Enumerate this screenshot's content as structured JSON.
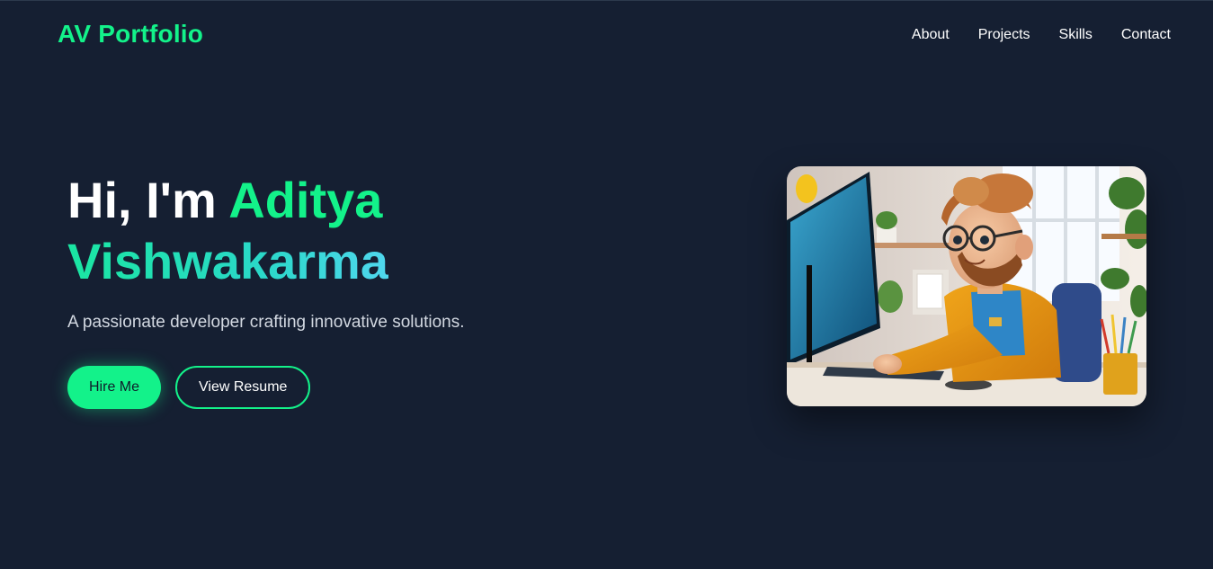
{
  "header": {
    "logo": "AV Portfolio",
    "nav": [
      {
        "label": "About"
      },
      {
        "label": "Projects"
      },
      {
        "label": "Skills"
      },
      {
        "label": "Contact"
      }
    ]
  },
  "hero": {
    "greeting": "Hi, I'm",
    "name_first": "Aditya",
    "name_last": "Vishwakarma",
    "tagline": "A passionate developer crafting innovative solutions.",
    "primary_button": "Hire Me",
    "secondary_button": "View Resume"
  },
  "illustration": {
    "description_icon": "developer-at-computer-image"
  },
  "colors": {
    "background": "#151f32",
    "accent": "#13f28a",
    "gradient_end": "#4fd7ee"
  }
}
